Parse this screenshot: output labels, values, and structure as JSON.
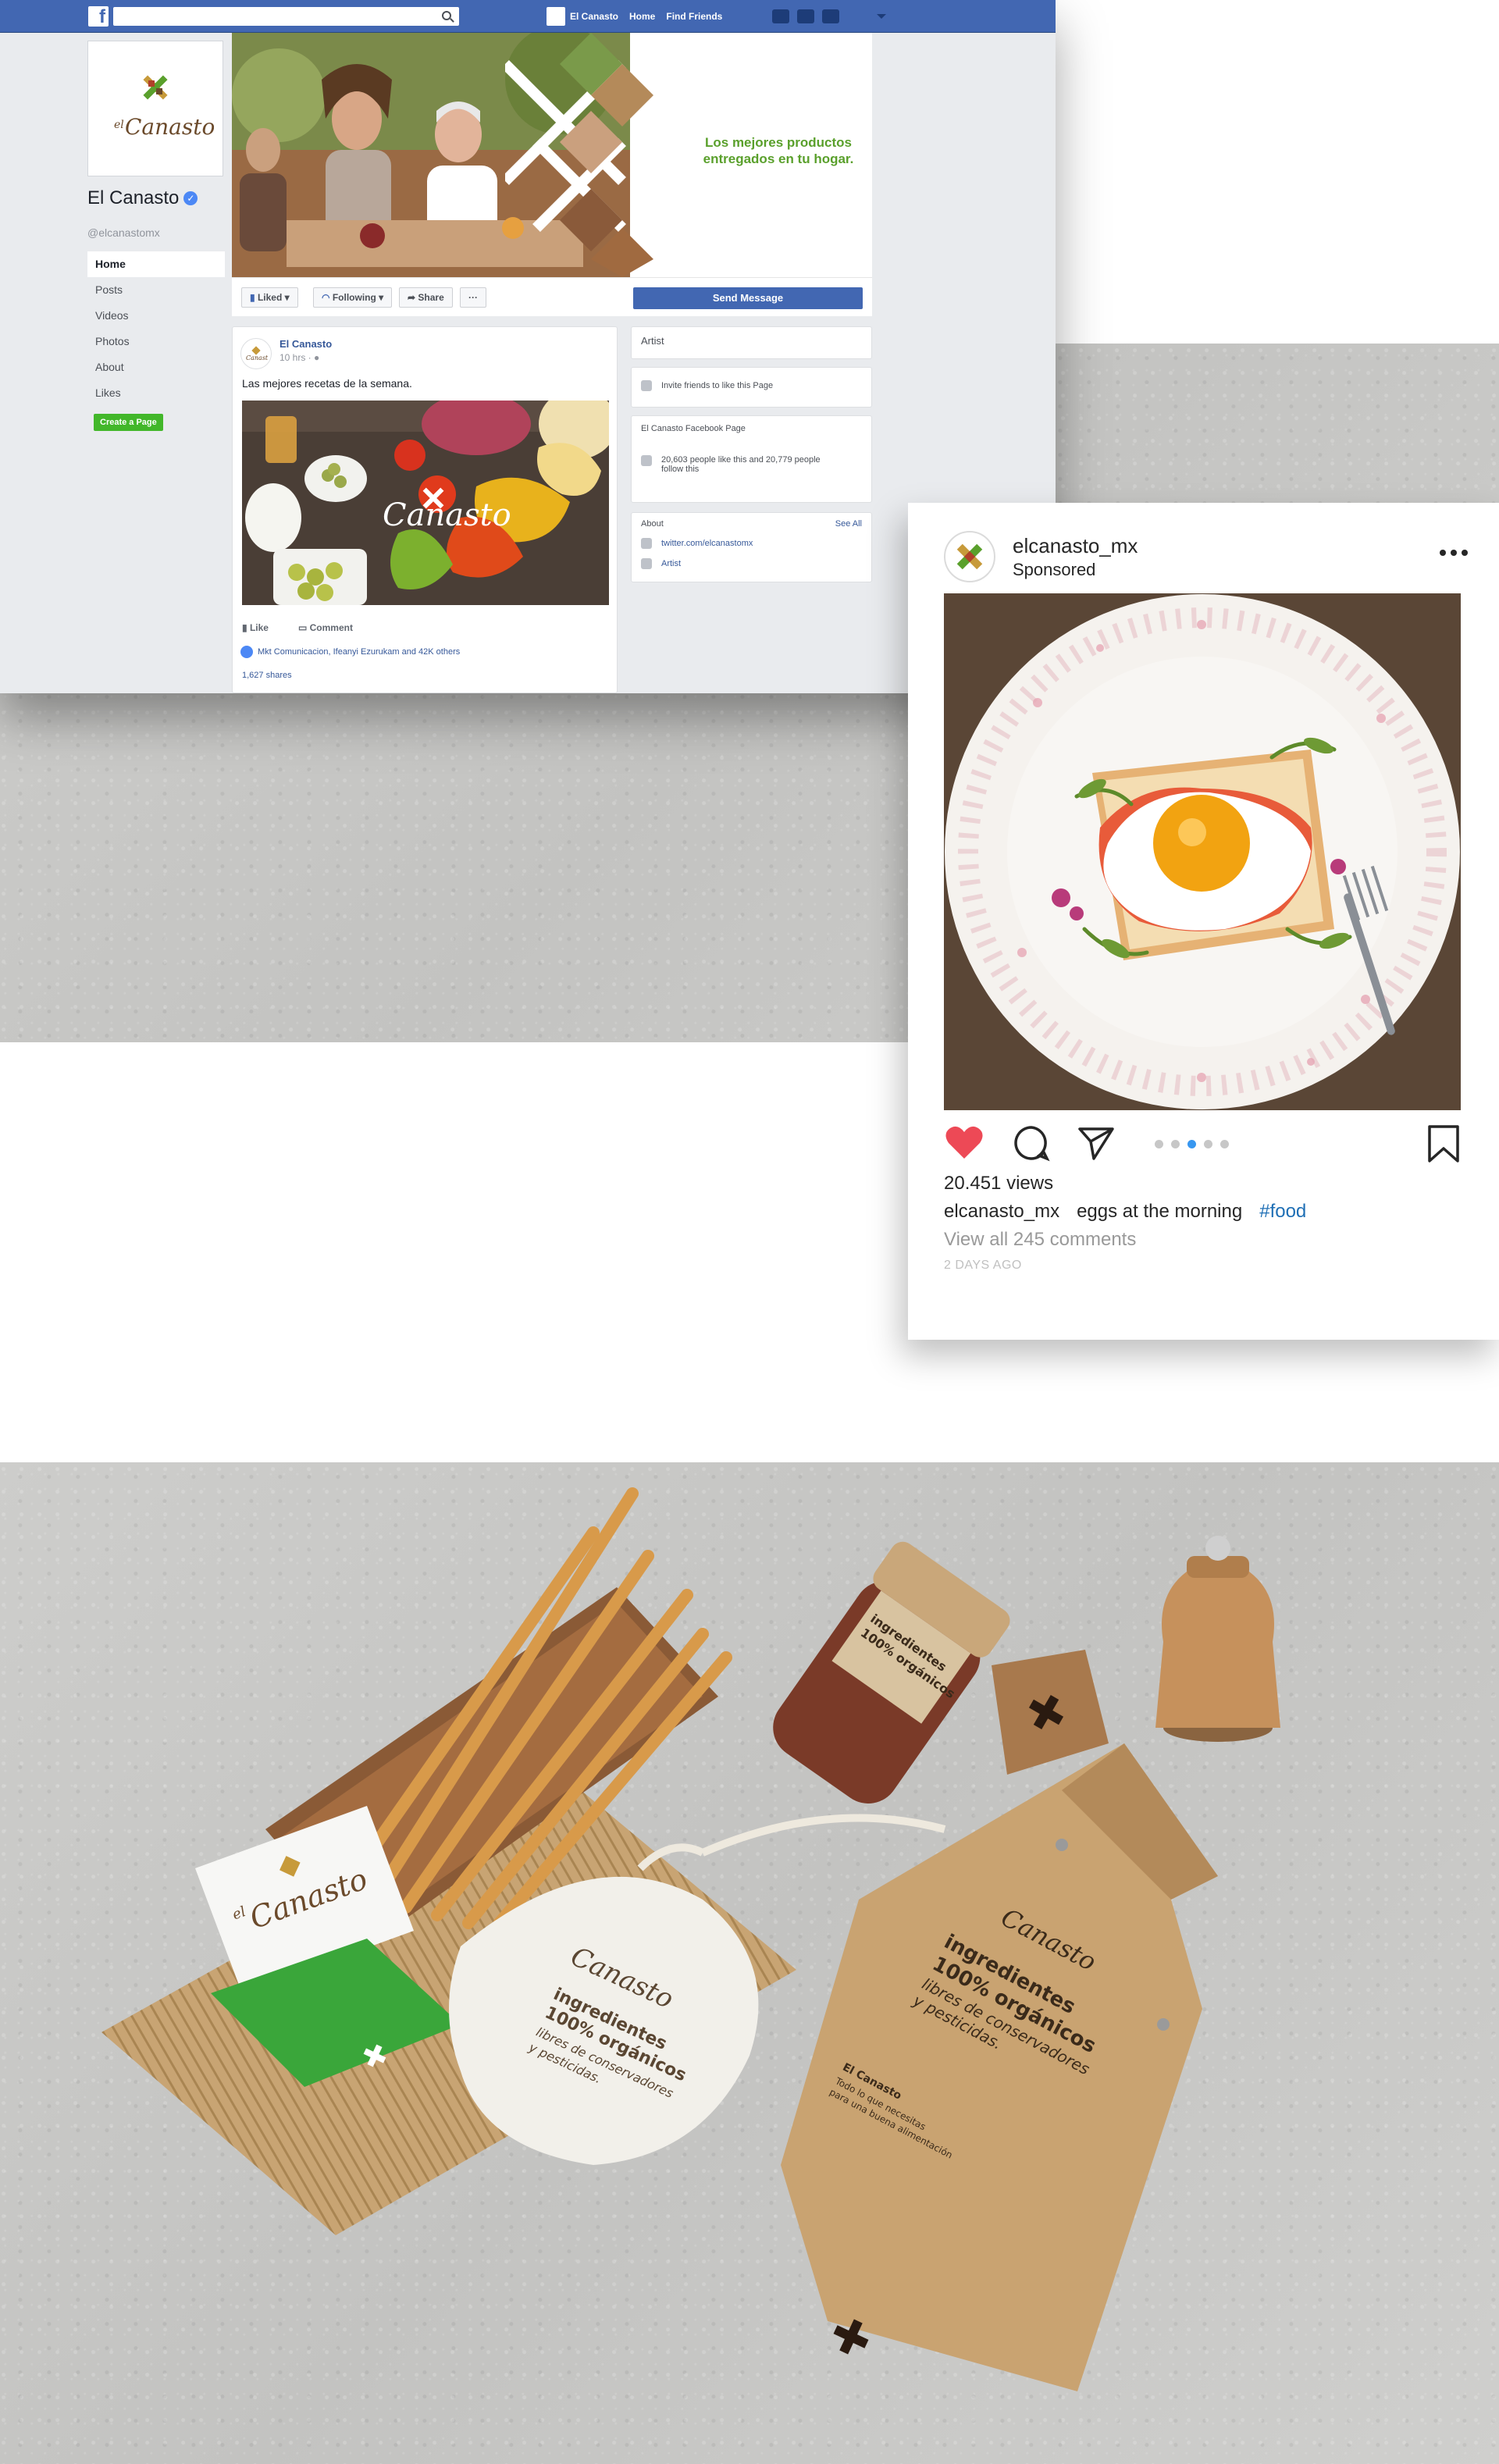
{
  "facebook": {
    "topbar": {
      "logo_letter": "f",
      "user_name": "El Canasto",
      "home": "Home",
      "find_friends": "Find Friends"
    },
    "page": {
      "name": "El Canasto",
      "verified_mark": "✓",
      "handle": "@elcanastomx",
      "logo_small": "el",
      "logo_big": "Canasto"
    },
    "menu": [
      "Home",
      "Posts",
      "Videos",
      "Photos",
      "About",
      "Likes"
    ],
    "create_page": "Create a Page",
    "cover": {
      "tagline_line1": "Los mejores productos",
      "tagline_line2": "entregados en tu hogar."
    },
    "actions": {
      "liked": "Liked",
      "following": "Following",
      "share": "Share",
      "more": "···",
      "send_message": "Send Message"
    },
    "post": {
      "author": "El Canasto",
      "time": "10 hrs · ",
      "text": "Las mejores recetas de la semana.",
      "image_logo": "Canasto",
      "like": "Like",
      "comment": "Comment",
      "likes_line": "Mkt Comunicacion, Ifeanyi Ezurukam and 42K others",
      "shares": "1,627 shares"
    },
    "sidebar": {
      "artist_title": "Artist",
      "invite": "Invite friends to like this Page",
      "fb_page_title": "El Canasto Facebook Page",
      "likes_text_1": "20,603 people like this and 20,779 people",
      "likes_text_2": "follow this",
      "about_title": "About",
      "see_all": "See All",
      "twitter": "twitter.com/elcanastomx",
      "category": "Artist"
    }
  },
  "instagram": {
    "username": "elcanasto_mx",
    "sponsored": "Sponsored",
    "views": "20.451 views",
    "caption_user": "elcanasto_mx",
    "caption_text": "eggs at the morning",
    "caption_tag": "#food",
    "comments": "View all 245 comments",
    "date": "2 DAYS AGO",
    "carousel_total": 5,
    "carousel_active": 3
  },
  "products": {
    "card_logo": "Canasto",
    "card_logo_small": "el",
    "bag_line1": "ingredientes",
    "bag_line2": "100% orgánicos",
    "bag_line3": "libres de conservadores",
    "bag_line4": "y pesticidas.",
    "jar_line1": "ingredientes",
    "jar_line2": "100% orgánicos",
    "paper_brand": "El Canasto",
    "paper_note_1": "Todo lo que necesitas",
    "paper_note_2": "para una buena alimentación"
  },
  "colors": {
    "fb_blue": "#4267b2",
    "brand_green": "#5aa02c",
    "brand_brown": "#6b4a2b",
    "ig_heart": "#ed4956"
  }
}
